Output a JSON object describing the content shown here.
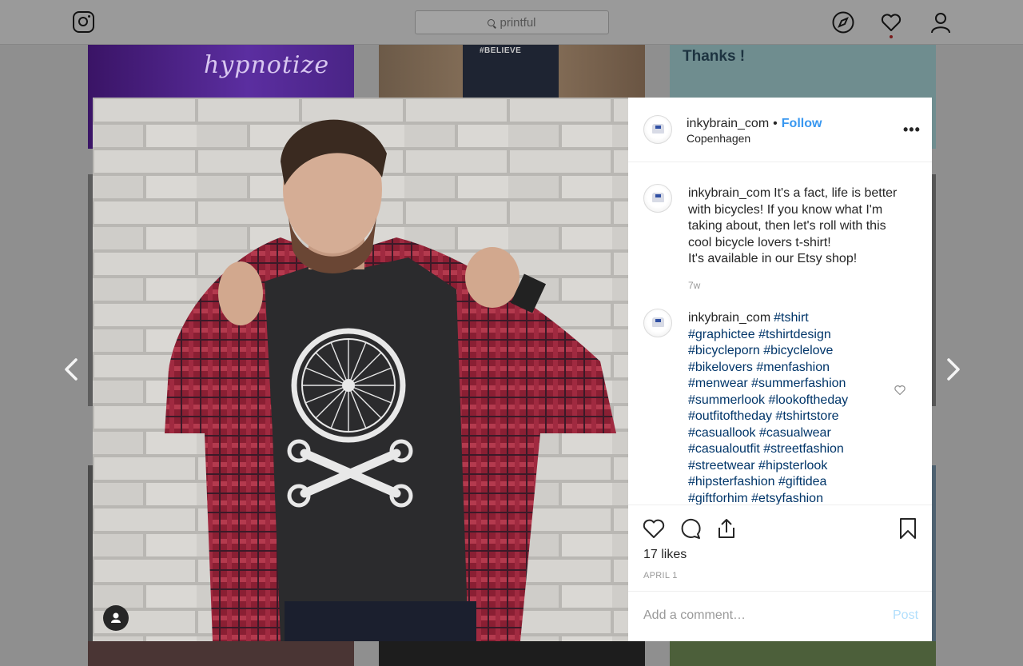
{
  "nav": {
    "search_text": "printful"
  },
  "background_tiles": {
    "tile1_text": "hypnotize",
    "tile2_text": "#BELIEVE",
    "tile3_text": "Thanks !"
  },
  "post": {
    "username": "inkybrain_com",
    "separator": "•",
    "follow_label": "Follow",
    "location": "Copenhagen",
    "more_label": "•••",
    "caption": {
      "username": "inkybrain_com",
      "lines": [
        "It's a fact, life is better",
        "with bicycles! If you know what I'm",
        "taking about, then let's roll with this",
        "cool bicycle lovers t-shirt!",
        "It's available in our Etsy shop!"
      ],
      "time": "7w"
    },
    "comment": {
      "username": "inkybrain_com",
      "first_tag": "#tshirt",
      "lines": [
        "#graphictee #tshirtdesign",
        "#bicycleporn #bicyclelove",
        "#bikelovers #menfashion",
        "#menwear #summerfashion",
        "#summerlook #lookoftheday",
        "#outfitoftheday #tshirtstore",
        "#casuallook #casualwear",
        "#casualoutfit #streetfashion",
        "#streetwear #hipsterlook",
        "#hipsterfashion #giftidea",
        "#giftforhim #etsyfashion"
      ]
    },
    "likes": "17 likes",
    "date": "APRIL 1",
    "comment_placeholder": "Add a comment…",
    "post_label": "Post"
  },
  "icons": {
    "logo": "instagram-icon",
    "search": "search-icon",
    "explore": "compass-icon",
    "activity": "heart-icon",
    "profile": "person-icon",
    "prev": "chevron-left-icon",
    "next": "chevron-right-icon",
    "like": "heart-outline-icon",
    "comment": "comment-icon",
    "share": "share-icon",
    "save": "bookmark-icon",
    "tags": "user-tag-icon"
  },
  "colors": {
    "follow": "#3897f0",
    "post_disabled": "#b2dffc",
    "hashtag": "#003569",
    "notification_dot": "#ed4956"
  }
}
